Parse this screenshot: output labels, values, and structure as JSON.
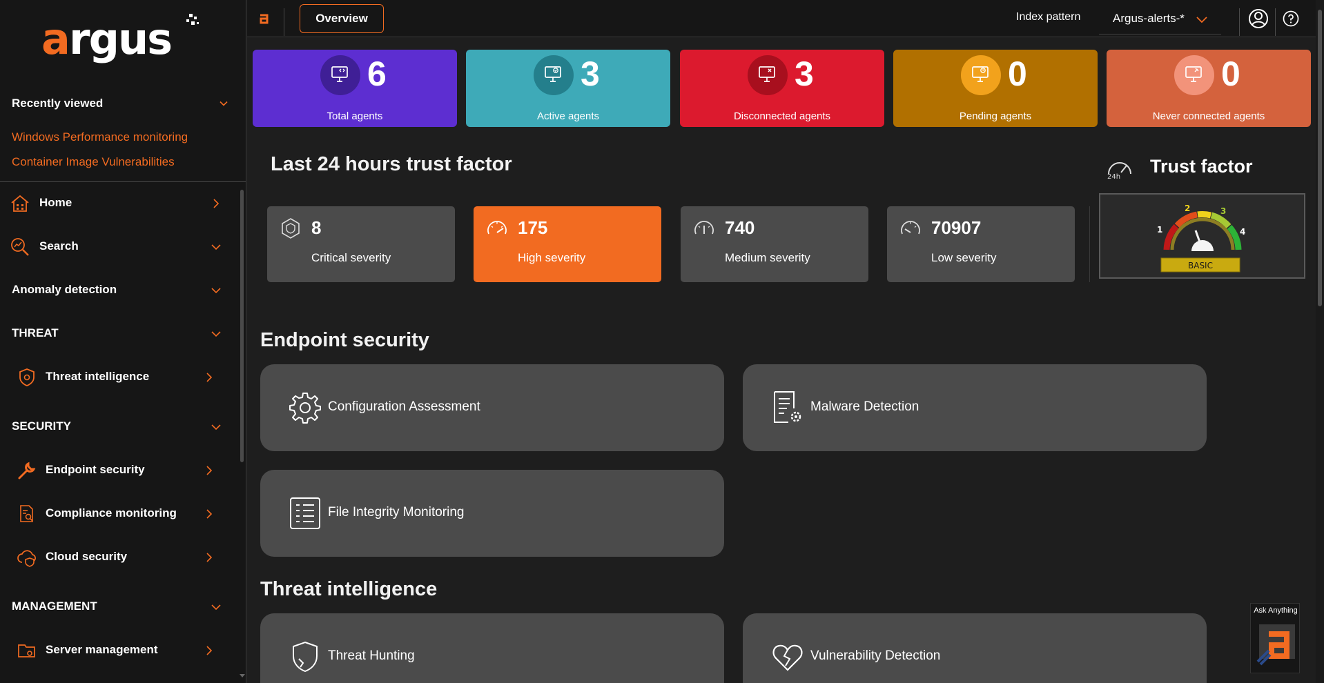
{
  "app": {
    "brand": "argus",
    "accent": "#f26b21"
  },
  "sidebar": {
    "recently_viewed": {
      "title": "Recently viewed",
      "links": [
        "Windows Performance monitoring",
        "Container Image Vulnerabilities"
      ]
    },
    "items": {
      "home": "Home",
      "search": "Search",
      "anomaly": "Anomaly detection",
      "threat_heading": "THREAT",
      "threat_intel": "Threat intelligence",
      "security_heading": "SECURITY",
      "endpoint": "Endpoint security",
      "compliance": "Compliance monitoring",
      "cloud": "Cloud security",
      "management_heading": "MANAGEMENT",
      "server": "Server management"
    }
  },
  "topbar": {
    "tab": "Overview",
    "index_label": "Index pattern",
    "index_value": "Argus-alerts-*"
  },
  "stats": [
    {
      "value": "6",
      "label": "Total agents",
      "color": "#5d2ed1",
      "circle": "#3f1f96"
    },
    {
      "value": "3",
      "label": "Active agents",
      "color": "#3eaab8",
      "circle": "#247f8c"
    },
    {
      "value": "3",
      "label": "Disconnected agents",
      "color": "#dc1a2e",
      "circle": "#a80f1e"
    },
    {
      "value": "0",
      "label": "Pending agents",
      "color": "#b17000",
      "circle": "#f2a21c"
    },
    {
      "value": "0",
      "label": "Never connected agents",
      "color": "#d4623d",
      "circle": "#f2937a"
    }
  ],
  "trust": {
    "title": "Last 24 hours trust factor",
    "severities": [
      {
        "value": "8",
        "label": "Critical severity"
      },
      {
        "value": "175",
        "label": "High severity"
      },
      {
        "value": "740",
        "label": "Medium severity"
      },
      {
        "value": "70907",
        "label": "Low severity"
      }
    ],
    "factor_title": "Trust factor",
    "badge_24h": "24h",
    "gauge": {
      "ticks": [
        "1",
        "2",
        "3",
        "4"
      ],
      "level": "BASIC"
    }
  },
  "endpoint": {
    "title": "Endpoint security",
    "cards": [
      "Configuration Assessment",
      "Malware Detection",
      "File Integrity Monitoring"
    ]
  },
  "threat": {
    "title": "Threat intelligence",
    "cards": [
      "Threat Hunting",
      "Vulnerability Detection"
    ]
  },
  "ask": {
    "label": "Ask Anything"
  }
}
